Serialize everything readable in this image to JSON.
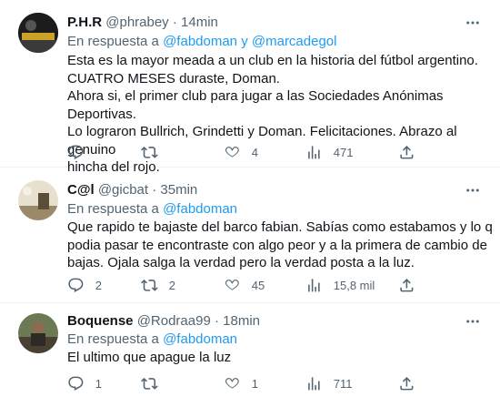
{
  "tweets": [
    {
      "name": "P.H.R",
      "handle": "@phrabey",
      "dot": "·",
      "time": "14min",
      "reply_prefix": "En respuesta a",
      "reply_mention_1": "@fabdoman",
      "reply_conj": "y",
      "reply_mention_2": "@marcadegol",
      "text_lines": [
        "Esta es la mayor meada a un club en la historia del fútbol argentino.",
        "CUATRO MESES duraste, Doman.",
        "Ahora si, el primer club para jugar a las Sociedades Anónimas Deportivas.",
        "Lo lograron Bullrich, Grindetti y Doman. Felicitaciones. Abrazo al genuino",
        "hincha del rojo."
      ],
      "replies": "",
      "retweets": "",
      "likes": "4",
      "views": "471"
    },
    {
      "name": "C@l",
      "handle": "@gicbat",
      "dot": "·",
      "time": "35min",
      "reply_prefix": "En respuesta a",
      "reply_mention_1": "@fabdoman",
      "text_lines": [
        "Que rapido te bajaste del barco fabian. Sabías como estabamos y lo q",
        "podia pasar te encontraste con algo peor y a la primera de cambio de",
        "bajas. Ojala salga la verdad pero la verdad posta a la luz."
      ],
      "replies": "2",
      "retweets": "2",
      "likes": "45",
      "views": "15,8 mil"
    },
    {
      "name": "Boquense",
      "handle": "@Rodraa99",
      "dot": "·",
      "time": "18min",
      "reply_prefix": "En respuesta a",
      "reply_mention_1": "@fabdoman",
      "text_lines": [
        "El ultimo que apague la luz"
      ],
      "replies": "1",
      "retweets": "",
      "likes": "1",
      "views": "711"
    }
  ],
  "icons": {
    "reply": "reply-icon",
    "retweet": "retweet-icon",
    "like": "heart-icon",
    "views": "views-icon",
    "share": "share-icon",
    "more": "more-icon"
  },
  "colors": {
    "text": "#0f1419",
    "secondary": "#536471",
    "mention": "#1d9bf0",
    "divider": "#eff3f4"
  }
}
